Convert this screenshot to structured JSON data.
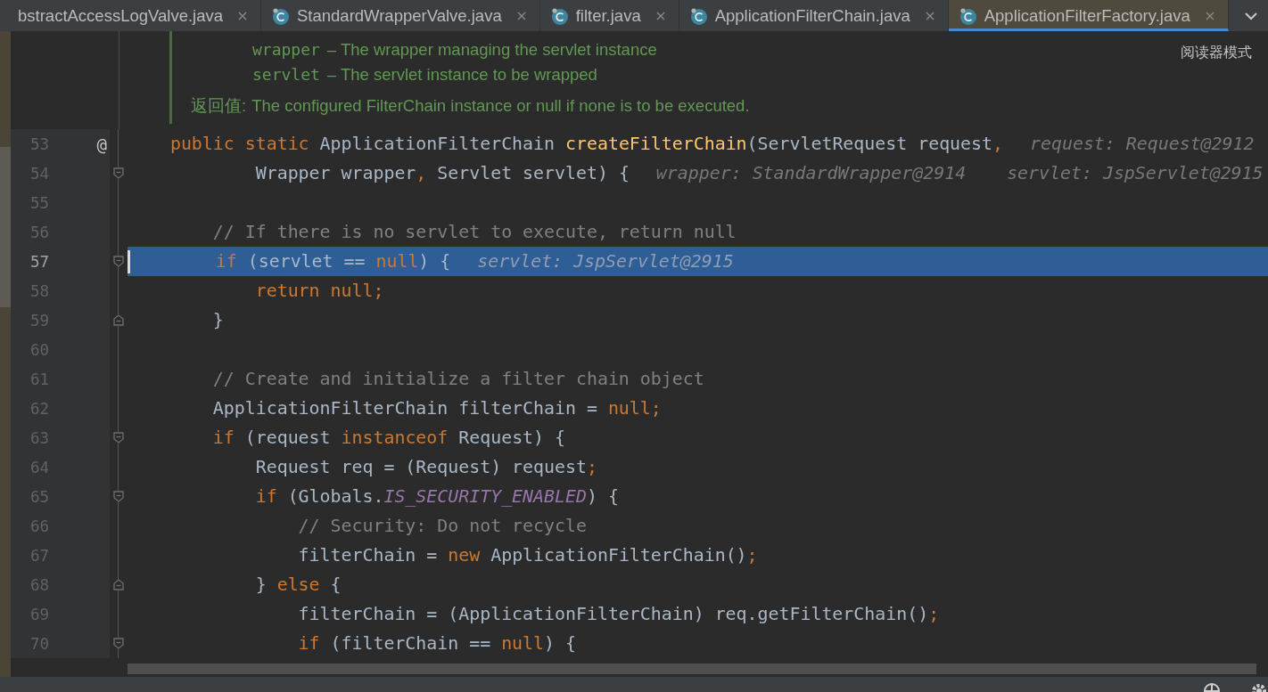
{
  "tabs": [
    {
      "label": "bstractAccessLogValve.java",
      "clipped": true,
      "selected": false
    },
    {
      "label": "StandardWrapperValve.java",
      "clipped": false,
      "selected": false
    },
    {
      "label": "filter.java",
      "clipped": false,
      "selected": false
    },
    {
      "label": "ApplicationFilterChain.java",
      "clipped": false,
      "selected": false
    },
    {
      "label": "ApplicationFilterFactory.java",
      "clipped": false,
      "selected": true
    }
  ],
  "doc": {
    "params": [
      {
        "name": "wrapper",
        "text": "– The wrapper managing the servlet instance"
      },
      {
        "name": "servlet",
        "text": "– The servlet instance to be wrapped"
      }
    ],
    "returns_label": "返回值:",
    "returns": "The configured FilterChain instance or null if none is to be executed."
  },
  "reader_mode": "阅读器模式",
  "lines": [
    {
      "number": "53",
      "marker": "@",
      "fold_start": false,
      "fold_end": false,
      "selected": false,
      "tokens": [
        {
          "kind": "keyword",
          "text": "    public"
        },
        {
          "kind": "keyword",
          "text": " static"
        },
        {
          "kind": "plain",
          "text": " ApplicationFilterChain "
        },
        {
          "kind": "method",
          "text": "createFilterChain"
        },
        {
          "kind": "plain",
          "text": "(ServletRequest request"
        },
        {
          "kind": "punct",
          "text": ","
        }
      ],
      "hints": [
        "request: Request@2912"
      ]
    },
    {
      "number": "54",
      "fold_start": true,
      "fold_end": false,
      "selected": false,
      "tokens": [
        {
          "kind": "plain",
          "text": "            Wrapper wrapper"
        },
        {
          "kind": "punct",
          "text": ","
        },
        {
          "kind": "plain",
          "text": " Servlet servlet) {"
        }
      ],
      "hints": [
        "wrapper: StandardWrapper@2914",
        "servlet: JspServlet@2915"
      ]
    },
    {
      "number": "55",
      "fold_start": false,
      "fold_end": false,
      "selected": false
    },
    {
      "number": "56",
      "fold_start": false,
      "fold_end": false,
      "selected": false,
      "tokens": [
        {
          "kind": "comment",
          "text": "        // If there is no servlet to execute, return null"
        }
      ]
    },
    {
      "number": "57",
      "fold_start": true,
      "fold_end": false,
      "selected": true,
      "tokens": [
        {
          "kind": "keyword",
          "text": "        if"
        },
        {
          "kind": "plain",
          "text": " (servlet == "
        },
        {
          "kind": "keyword",
          "text": "null"
        },
        {
          "kind": "plain",
          "text": ") {"
        }
      ],
      "hints": [
        "servlet: JspServlet@2915"
      ]
    },
    {
      "number": "58",
      "fold_start": false,
      "fold_end": false,
      "selected": false,
      "tokens": [
        {
          "kind": "keyword",
          "text": "            return"
        },
        {
          "kind": "keyword",
          "text": " null"
        },
        {
          "kind": "punct",
          "text": ";"
        }
      ]
    },
    {
      "number": "59",
      "fold_start": false,
      "fold_end": true,
      "selected": false,
      "tokens": [
        {
          "kind": "plain",
          "text": "        }"
        }
      ]
    },
    {
      "number": "60",
      "fold_start": false,
      "fold_end": false,
      "selected": false
    },
    {
      "number": "61",
      "fold_start": false,
      "fold_end": false,
      "selected": false,
      "tokens": [
        {
          "kind": "comment",
          "text": "        // Create and initialize a filter chain object"
        }
      ]
    },
    {
      "number": "62",
      "fold_start": false,
      "fold_end": false,
      "selected": false,
      "tokens": [
        {
          "kind": "plain",
          "text": "        ApplicationFilterChain filterChain = "
        },
        {
          "kind": "keyword",
          "text": "null"
        },
        {
          "kind": "punct",
          "text": ";"
        }
      ]
    },
    {
      "number": "63",
      "fold_start": true,
      "fold_end": false,
      "selected": false,
      "tokens": [
        {
          "kind": "keyword",
          "text": "        if"
        },
        {
          "kind": "plain",
          "text": " (request "
        },
        {
          "kind": "keyword",
          "text": "instanceof"
        },
        {
          "kind": "plain",
          "text": " Request) {"
        }
      ]
    },
    {
      "number": "64",
      "fold_start": false,
      "fold_end": false,
      "selected": false,
      "tokens": [
        {
          "kind": "plain",
          "text": "            Request req = (Request) request"
        },
        {
          "kind": "punct",
          "text": ";"
        }
      ]
    },
    {
      "number": "65",
      "fold_start": true,
      "fold_end": false,
      "selected": false,
      "tokens": [
        {
          "kind": "keyword",
          "text": "            if"
        },
        {
          "kind": "plain",
          "text": " (Globals."
        },
        {
          "kind": "constant",
          "text": "IS_SECURITY_ENABLED"
        },
        {
          "kind": "plain",
          "text": ") {"
        }
      ]
    },
    {
      "number": "66",
      "fold_start": false,
      "fold_end": false,
      "selected": false,
      "tokens": [
        {
          "kind": "comment",
          "text": "                // Security: Do not recycle"
        }
      ]
    },
    {
      "number": "67",
      "fold_start": false,
      "fold_end": false,
      "selected": false,
      "tokens": [
        {
          "kind": "plain",
          "text": "                filterChain = "
        },
        {
          "kind": "keyword",
          "text": "new"
        },
        {
          "kind": "plain",
          "text": " ApplicationFilterChain()"
        },
        {
          "kind": "punct",
          "text": ";"
        }
      ]
    },
    {
      "number": "68",
      "fold_start": false,
      "fold_end": true,
      "selected": false,
      "tokens": [
        {
          "kind": "plain",
          "text": "            } "
        },
        {
          "kind": "keyword",
          "text": "else"
        },
        {
          "kind": "plain",
          "text": " {"
        }
      ]
    },
    {
      "number": "69",
      "fold_start": false,
      "fold_end": false,
      "selected": false,
      "tokens": [
        {
          "kind": "plain",
          "text": "                filterChain = (ApplicationFilterChain) req.getFilterChain()"
        },
        {
          "kind": "punct",
          "text": ";"
        }
      ]
    },
    {
      "number": "70",
      "fold_start": true,
      "fold_end": false,
      "selected": false,
      "tokens": [
        {
          "kind": "keyword",
          "text": "                if"
        },
        {
          "kind": "plain",
          "text": " (filterChain == "
        },
        {
          "kind": "keyword",
          "text": "null"
        },
        {
          "kind": "plain",
          "text": ") {"
        }
      ]
    }
  ]
}
